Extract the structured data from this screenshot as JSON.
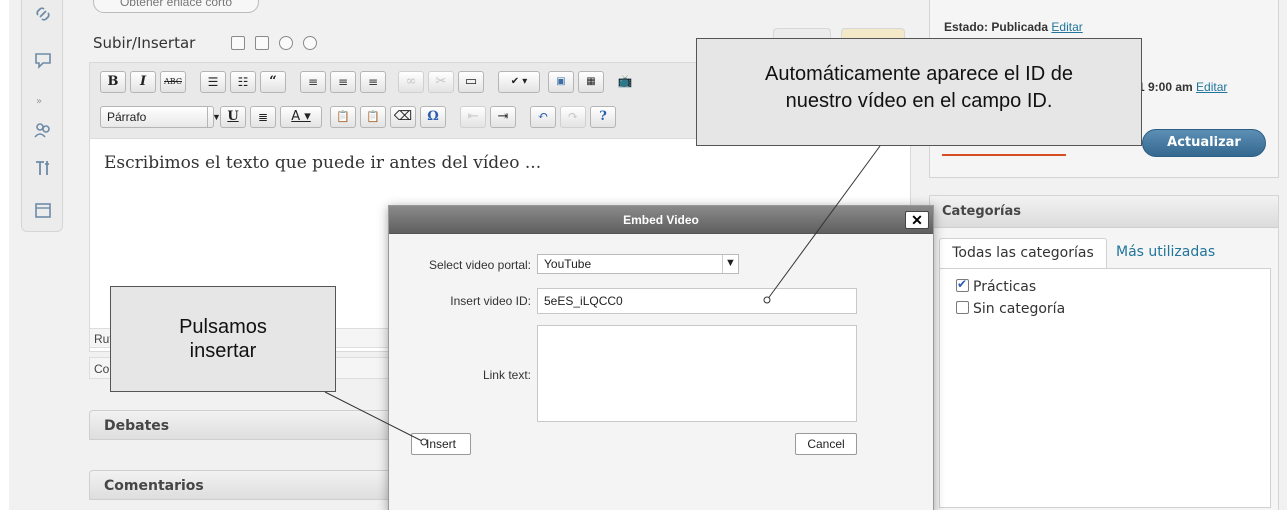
{
  "sidebar_menu": {
    "icons": [
      "link-icon",
      "comment-icon",
      "users-icon",
      "tools-icon",
      "calendar-icon"
    ],
    "separator": "»"
  },
  "editor": {
    "short_link_button": "Obtener enlace corto",
    "upload_label": "Subir/Insertar",
    "format_select": "Párrafo",
    "content_text": "Escribimos el texto que puede ir antes del vídeo ...",
    "path_label": "Ruta",
    "word_count_label": "Co"
  },
  "postboxes": {
    "discussion": "Debates",
    "comments": "Comentarios"
  },
  "publish": {
    "status_label": "Estado:",
    "status_value": "Publicada",
    "edit_link": "Editar",
    "schedule_text": "1 9:00 am",
    "schedule_edit": "Editar",
    "update_button": "Actualizar"
  },
  "categories": {
    "title": "Categorías",
    "tab_all": "Todas las categorías",
    "tab_most_used": "Más utilizadas",
    "items": [
      {
        "label": "Prácticas",
        "checked": true
      },
      {
        "label": "Sin categoría",
        "checked": false
      }
    ]
  },
  "modal": {
    "title": "Embed Video",
    "close_symbol": "✕",
    "portal_label": "Select video portal:",
    "portal_value": "YouTube",
    "id_label": "Insert video ID:",
    "id_value": "5eES_iLQCC0",
    "link_text_label": "Link text:",
    "insert_button": "Insert",
    "cancel_button": "Cancel"
  },
  "annotations": {
    "right_callout_line1": "Automáticamente aparece el ID de",
    "right_callout_line2": "nuestro vídeo en el campo ID.",
    "left_callout_line1": "Pulsamos",
    "left_callout_line2": "insertar"
  }
}
